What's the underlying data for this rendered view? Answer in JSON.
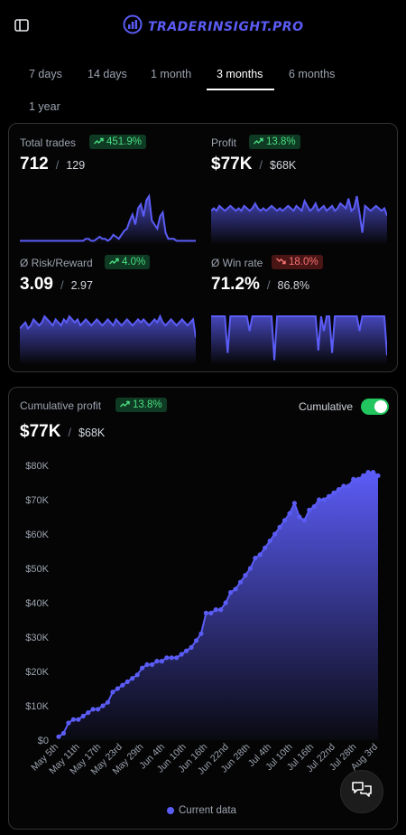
{
  "app": {
    "brand": "TRADERINSIGHT.PRO"
  },
  "icons": {
    "sidebar": "sidebar-toggle-icon",
    "logo": "bar-chart-logo-icon",
    "trend_up": "trend-up-icon",
    "trend_down": "trend-down-icon",
    "chat": "chat-bubbles-icon"
  },
  "colors": {
    "accent": "#5b5cf6",
    "positive": "#4ade80",
    "negative": "#f87171",
    "toggle_on": "#22c55e",
    "background": "#000000"
  },
  "periods": [
    "7 days",
    "14 days",
    "1 month",
    "3 months",
    "6 months",
    "1 year"
  ],
  "active_period": "3 months",
  "metrics": [
    {
      "label": "Total trades",
      "change": "451.9%",
      "direction": "up",
      "value": "712",
      "previous": "129",
      "trend": [
        2,
        2,
        2,
        2,
        2,
        2,
        2,
        2,
        2,
        2,
        2,
        2,
        2,
        2,
        2,
        2,
        2,
        2,
        2,
        2,
        2,
        2,
        2,
        2,
        3,
        3,
        2,
        2,
        3,
        4,
        3,
        3,
        2,
        3,
        5,
        4,
        3,
        5,
        7,
        8,
        12,
        15,
        10,
        18,
        20,
        14,
        22,
        24,
        12,
        10,
        8,
        14,
        16,
        6,
        3,
        3,
        3,
        2,
        2,
        2,
        2,
        2,
        2,
        2,
        2
      ]
    },
    {
      "label": "Profit",
      "change": "13.8%",
      "direction": "up",
      "value": "$77K",
      "previous": "$68K",
      "trend": [
        14,
        15,
        14,
        16,
        15,
        14,
        15,
        16,
        15,
        14,
        15,
        14,
        16,
        15,
        14,
        15,
        17,
        15,
        14,
        15,
        14,
        15,
        16,
        15,
        14,
        15,
        14,
        15,
        16,
        15,
        14,
        16,
        15,
        14,
        18,
        16,
        14,
        15,
        17,
        14,
        15,
        16,
        14,
        15,
        16,
        14,
        15,
        17,
        16,
        15,
        19,
        14,
        15,
        20,
        13,
        5,
        16,
        15,
        14,
        15,
        16,
        15,
        14,
        15,
        12
      ]
    },
    {
      "label": "Ø Risk/Reward",
      "change": "4.0%",
      "direction": "up",
      "value": "3.09",
      "previous": "2.97",
      "trend": [
        12,
        13,
        14,
        12,
        13,
        15,
        14,
        13,
        14,
        16,
        15,
        14,
        13,
        15,
        14,
        13,
        15,
        14,
        16,
        15,
        14,
        15,
        13,
        14,
        15,
        14,
        13,
        14,
        15,
        14,
        13,
        14,
        15,
        14,
        13,
        15,
        14,
        13,
        14,
        15,
        14,
        13,
        14,
        15,
        14,
        15,
        14,
        13,
        14,
        15,
        14,
        16,
        14,
        13,
        14,
        15,
        14,
        13,
        14,
        15,
        14,
        13,
        14,
        15,
        9
      ]
    },
    {
      "label": "Ø Win rate",
      "change": "18.0%",
      "direction": "down",
      "value": "71.2%",
      "previous": "86.8%",
      "trend": [
        20,
        20,
        20,
        20,
        20,
        20,
        5,
        20,
        20,
        20,
        20,
        20,
        20,
        20,
        14,
        20,
        20,
        20,
        20,
        20,
        20,
        20,
        20,
        2,
        20,
        20,
        20,
        20,
        20,
        20,
        20,
        20,
        20,
        20,
        20,
        20,
        20,
        20,
        20,
        6,
        20,
        14,
        20,
        20,
        5,
        20,
        20,
        20,
        20,
        20,
        20,
        20,
        20,
        20,
        14,
        20,
        20,
        20,
        20,
        20,
        20,
        20,
        20,
        20,
        4
      ]
    }
  ],
  "cumulative": {
    "label": "Cumulative profit",
    "change": "13.8%",
    "direction": "up",
    "value": "$77K",
    "previous": "$68K",
    "toggle_label": "Cumulative",
    "toggle_on": true,
    "legend": "Current data"
  },
  "chart_data": {
    "type": "area",
    "series": [
      {
        "name": "Current data",
        "values": [
          1,
          2,
          5,
          6,
          6,
          7,
          8,
          9,
          9,
          10,
          11,
          14,
          15,
          16,
          17,
          18,
          19,
          21,
          22,
          22,
          23,
          23,
          24,
          24,
          24,
          25,
          26,
          27,
          29,
          31,
          37,
          37,
          38,
          38,
          40,
          43,
          44,
          46,
          48,
          50,
          53,
          54,
          56,
          58,
          60,
          62,
          64,
          66,
          69,
          65,
          64,
          67,
          68,
          70,
          70,
          71,
          72,
          73,
          74,
          74,
          76,
          76,
          77,
          78,
          78,
          77
        ]
      }
    ],
    "x_tick_labels": [
      "May 5th",
      "May 11th",
      "May 17th",
      "May 23rd",
      "May 29th",
      "Jun 4th",
      "Jun 10th",
      "Jun 16th",
      "Jun 22nd",
      "Jun 28th",
      "Jul 4th",
      "Jul 10th",
      "Jul 16th",
      "Jul 22nd",
      "Jul 28th",
      "Aug 3rd"
    ],
    "y_tick_labels": [
      "$0",
      "$10K",
      "$20K",
      "$30K",
      "$40K",
      "$50K",
      "$60K",
      "$70K",
      "$80K"
    ],
    "ylim": [
      0,
      80
    ],
    "grid": false,
    "legend_position": "bottom"
  }
}
